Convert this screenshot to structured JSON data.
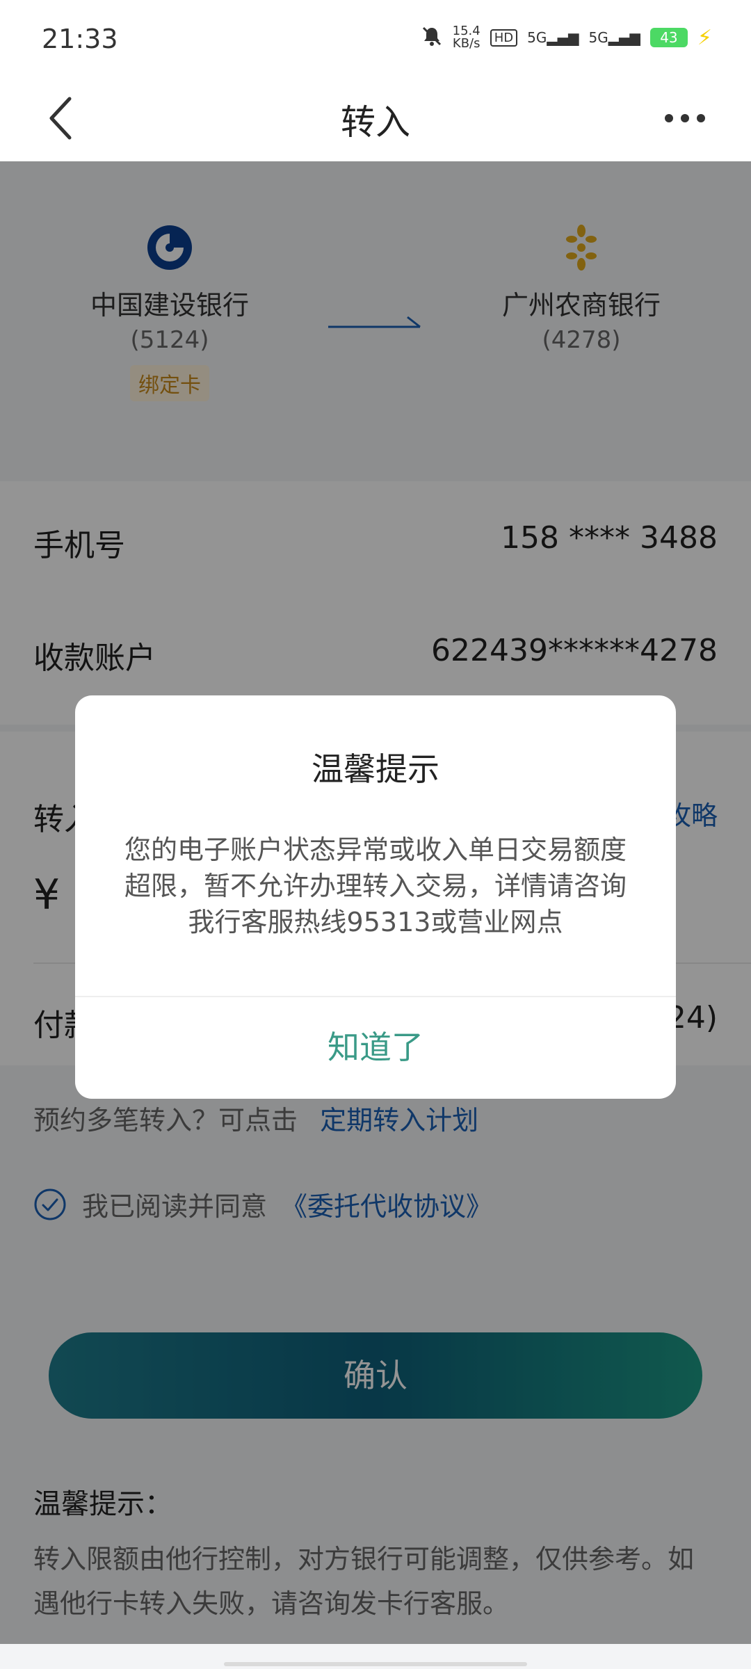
{
  "status": {
    "time": "21:33",
    "net_speed_value": "15.4",
    "net_speed_unit": "KB/s",
    "hd_label": "HD",
    "sim1": "5G",
    "sim2": "5G",
    "battery": "43"
  },
  "nav": {
    "title": "转入"
  },
  "transfer": {
    "from_bank": "中国建设银行",
    "from_account": "(5124)",
    "from_tag": "绑定卡",
    "to_bank": "广州农商银行",
    "to_account": "(4278)"
  },
  "form": {
    "phone_label": "手机号",
    "phone_value": "158 **** 3488",
    "payee_label": "收款账户",
    "payee_value": "622439******4278",
    "amount_label_partial": "转入",
    "amount_strategy_partial": "攻略",
    "currency_symbol": "¥",
    "payment_label_partial": "付款",
    "payment_value_partial": "24)",
    "schedule_prompt": "预约多笔转入？可点击",
    "schedule_link": "定期转入计划",
    "agree_text": "我已阅读并同意",
    "agreement_link": "《委托代收协议》",
    "confirm_label": "确认",
    "tips_title": "温馨提示：",
    "tips_body": "转入限额由他行控制，对方银行可能调整，仅供参考。如遇他行卡转入失败，请咨询发卡行客服。"
  },
  "dialog": {
    "title": "温馨提示",
    "message": "您的电子账户状态异常或收入单日交易额度超限，暂不允许办理转入交易，详情请咨询我行客服热线95313或营业网点",
    "button": "知道了"
  },
  "colors": {
    "accent_blue": "#1a5fb4",
    "dialog_button": "#3a9a87",
    "ccb_blue": "#0b3f8f",
    "grcb_gold": "#e0a91c"
  }
}
